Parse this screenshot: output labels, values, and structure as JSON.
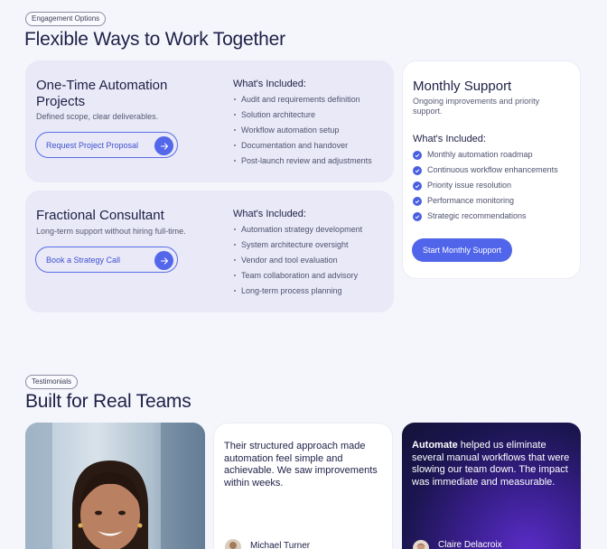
{
  "engagement": {
    "badge": "Engagement Options",
    "heading": "Flexible Ways to Work Together",
    "project": {
      "title": "One-Time Automation Projects",
      "subtitle": "Defined scope, clear deliverables.",
      "button": "Request Project Proposal",
      "included_title": "What's Included:",
      "items": [
        "Audit and requirements definition",
        "Solution architecture",
        "Workflow automation setup",
        "Documentation and handover",
        "Post-launch review and adjustments"
      ]
    },
    "fractional": {
      "title": "Fractional Consultant",
      "subtitle": "Long-term support without hiring full-time.",
      "button": "Book a Strategy Call",
      "included_title": "What's Included:",
      "items": [
        "Automation strategy development",
        "System architecture oversight",
        "Vendor and tool evaluation",
        "Team collaboration and advisory",
        "Long-term process planning"
      ]
    },
    "monthly": {
      "title": "Monthly Support",
      "subtitle": "Ongoing improvements and priority support.",
      "included_title": "What's Included:",
      "items": [
        "Monthly automation roadmap",
        "Continuous workflow enhancements",
        "Priority issue resolution",
        "Performance monitoring",
        "Strategic recommendations"
      ],
      "button": "Start Monthly Support"
    }
  },
  "testimonials": {
    "badge": "Testimonials",
    "heading": "Built for Real Teams",
    "quote1": {
      "text": "Their structured approach made automation feel simple and achievable. We saw improvements within weeks.",
      "author": "Michael Turner"
    },
    "quote2": {
      "brand": "Automate",
      "text": " helped us eliminate several manual workflows that were slowing our team down. The impact was immediate and measurable.",
      "author": "Claire Delacroix"
    }
  },
  "colors": {
    "accent": "#5065ea",
    "background": "#f5f5fc",
    "card_lavender": "#e9e9f7",
    "dark_card": "#1b1550"
  },
  "icons": {
    "cta_arrow": "arrow-right-icon",
    "check": "check-circle-icon"
  }
}
